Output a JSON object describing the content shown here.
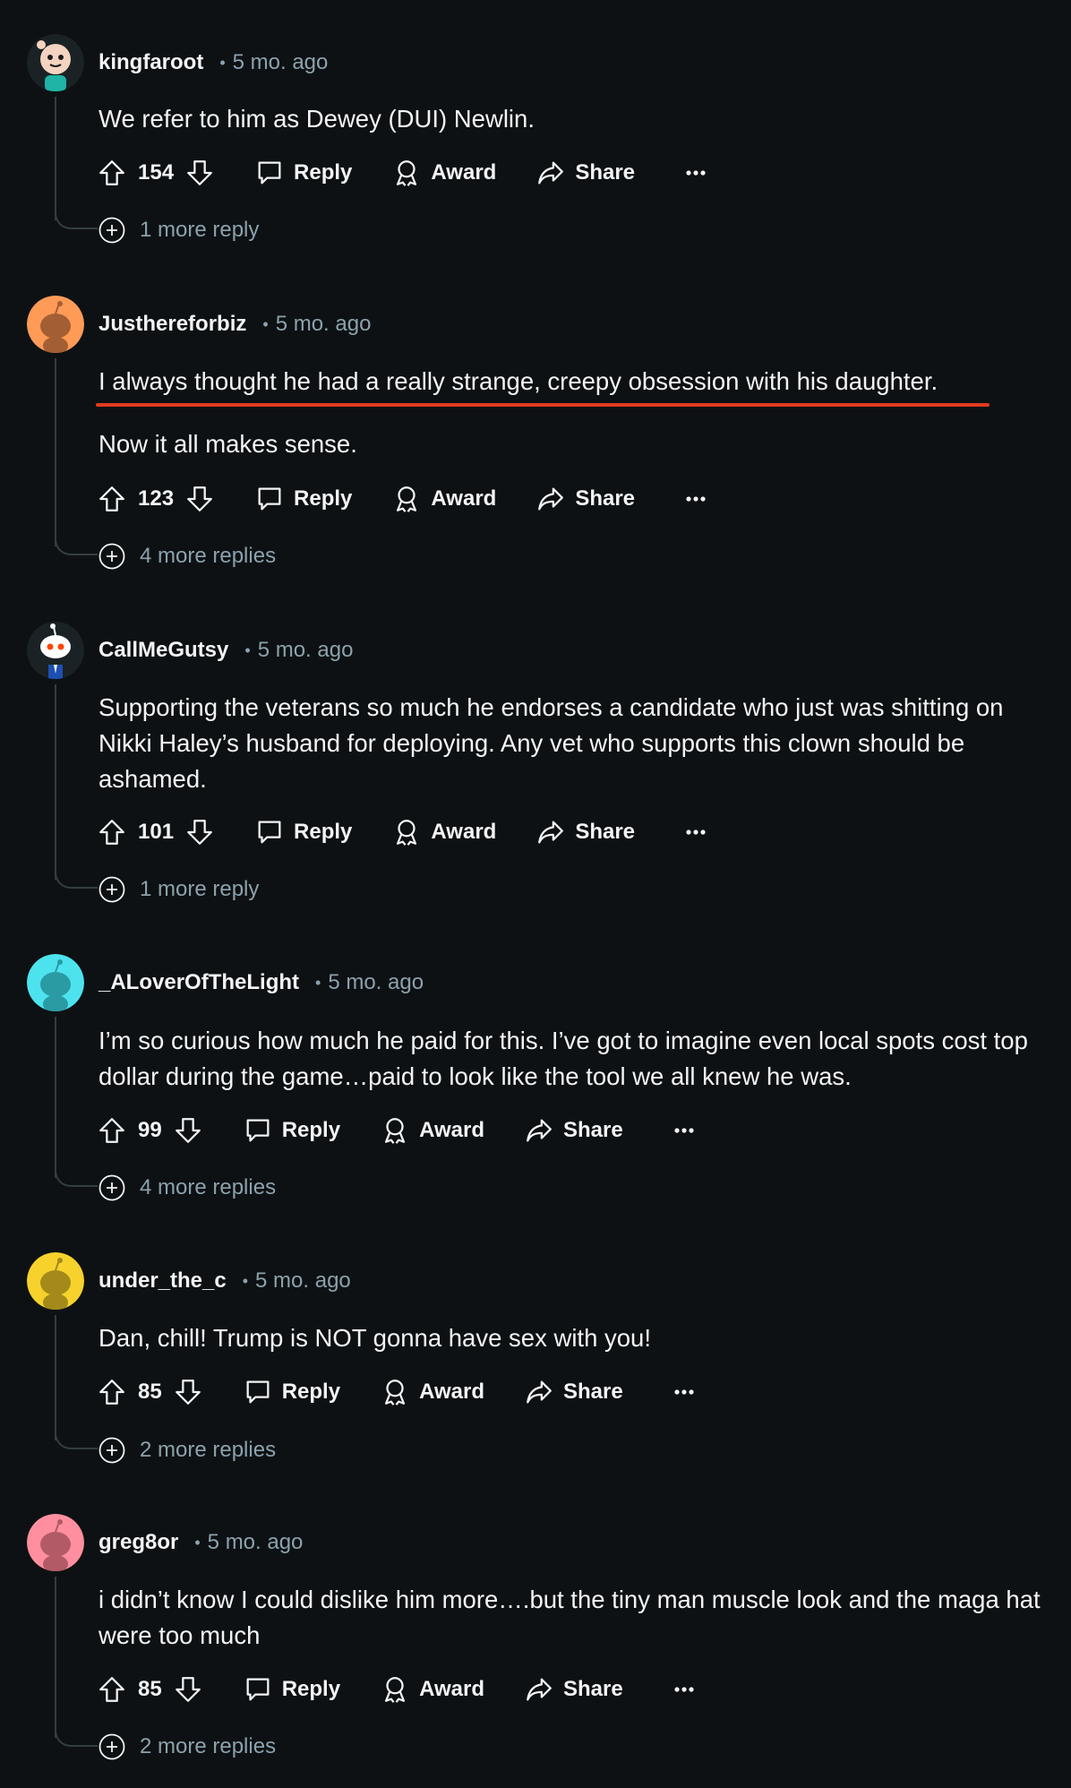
{
  "comments": [
    {
      "username": "kingfaroot",
      "separator": "•",
      "time": "5 mo. ago",
      "paragraphs": [
        "We refer to him as Dewey (DUI) Newlin."
      ],
      "votes": "154",
      "reply_label": "Reply",
      "award_label": "Award",
      "share_label": "Share",
      "more_replies": "1 more reply",
      "avatar_color": "#1a2226"
    },
    {
      "username": "Justhereforbiz",
      "separator": "•",
      "time": "5 mo. ago",
      "paragraphs": [
        "I always thought he had a really strange, creepy obsession with his daughter.",
        "Now it all makes sense."
      ],
      "votes": "123",
      "reply_label": "Reply",
      "award_label": "Award",
      "share_label": "Share",
      "more_replies": "4 more replies",
      "avatar_color": "#ff9a57"
    },
    {
      "username": "CallMeGutsy",
      "separator": "•",
      "time": "5 mo. ago",
      "paragraphs": [
        "Supporting the veterans so much he endorses a candidate who just was shitting on Nikki Haley’s husband for deploying. Any vet who supports this clown should be ashamed."
      ],
      "votes": "101",
      "reply_label": "Reply",
      "award_label": "Award",
      "share_label": "Share",
      "more_replies": "1 more reply",
      "avatar_color": "#1a2226"
    },
    {
      "username": "_ALoverOfTheLight",
      "separator": "•",
      "time": "5 mo. ago",
      "paragraphs": [
        "I’m so curious how much he paid for this. I’ve got to imagine even local spots cost top dollar during the game…paid to look like the tool we all knew he was."
      ],
      "votes": "99",
      "reply_label": "Reply",
      "award_label": "Award",
      "share_label": "Share",
      "more_replies": "4 more replies",
      "avatar_color": "#4de3ee"
    },
    {
      "username": "under_the_c",
      "separator": "•",
      "time": "5 mo. ago",
      "paragraphs": [
        "Dan, chill! Trump is NOT gonna have sex with you!"
      ],
      "votes": "85",
      "reply_label": "Reply",
      "award_label": "Award",
      "share_label": "Share",
      "more_replies": "2 more replies",
      "avatar_color": "#f7d22d"
    },
    {
      "username": "greg8or",
      "separator": "•",
      "time": "5 mo. ago",
      "paragraphs": [
        "i didn’t know I could dislike him more….but the tiny man muscle look and the maga hat were too much"
      ],
      "votes": "85",
      "reply_label": "Reply",
      "award_label": "Award",
      "share_label": "Share",
      "more_replies": "2 more replies",
      "avatar_color": "#ff8f9f"
    }
  ],
  "icons": {
    "upvote": "upvote-arrow-icon",
    "downvote": "downvote-arrow-icon",
    "reply": "speech-bubble-icon",
    "award": "award-ribbon-icon",
    "share": "share-arrow-icon",
    "more": "ellipsis-icon",
    "expand": "plus-circle-icon"
  },
  "colors": {
    "background": "#0e1113",
    "text": "#f2f4f5",
    "meta_text": "#8ba2ad",
    "thread_line": "#333d42",
    "highlight_underline": "#e23b1f"
  }
}
